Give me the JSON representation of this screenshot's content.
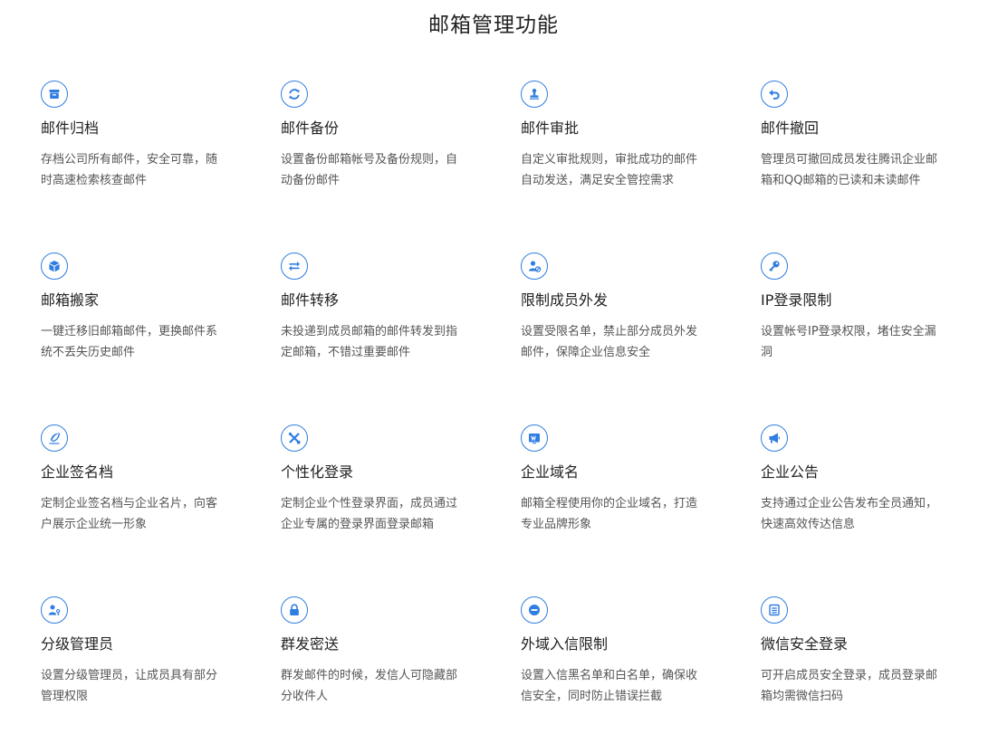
{
  "page": {
    "title": "邮箱管理功能"
  },
  "colors": {
    "accent": "#2f7de1",
    "title": "#222222",
    "text": "#555555"
  },
  "features": [
    {
      "title": "邮件归档",
      "desc": "存档公司所有邮件，安全可靠，随时高速检索核查邮件",
      "icon": "archive-icon"
    },
    {
      "title": "邮件备份",
      "desc": "设置备份邮箱帐号及备份规则，自动备份邮件",
      "icon": "sync-icon"
    },
    {
      "title": "邮件审批",
      "desc": "自定义审批规则，审批成功的邮件自动发送，满足安全管控需求",
      "icon": "stamp-icon"
    },
    {
      "title": "邮件撤回",
      "desc": "管理员可撤回成员发往腾讯企业邮箱和QQ邮箱的已读和未读邮件",
      "icon": "undo-icon"
    },
    {
      "title": "邮箱搬家",
      "desc": "一键迁移旧邮箱邮件，更换邮件系统不丢失历史邮件",
      "icon": "box-icon"
    },
    {
      "title": "邮件转移",
      "desc": "未投递到成员邮箱的邮件转发到指定邮箱，不错过重要邮件",
      "icon": "transfer-icon"
    },
    {
      "title": "限制成员外发",
      "desc": "设置受限名单，禁止部分成员外发邮件，保障企业信息安全",
      "icon": "user-block-icon"
    },
    {
      "title": "IP登录限制",
      "desc": "设置帐号IP登录权限，堵住安全漏洞",
      "icon": "key-icon"
    },
    {
      "title": "企业签名档",
      "desc": "定制企业签名档与企业名片，向客户展示企业统一形象",
      "icon": "feather-icon"
    },
    {
      "title": "个性化登录",
      "desc": "定制企业个性登录界面，成员通过企业专属的登录界面登录邮箱",
      "icon": "tools-icon"
    },
    {
      "title": "企业域名",
      "desc": "邮箱全程使用你的企业域名，打造专业品牌形象",
      "icon": "domain-icon"
    },
    {
      "title": "企业公告",
      "desc": "支持通过企业公告发布全员通知，快速高效传达信息",
      "icon": "megaphone-icon"
    },
    {
      "title": "分级管理员",
      "desc": "设置分级管理员，让成员具有部分管理权限",
      "icon": "admin-key-icon"
    },
    {
      "title": "群发密送",
      "desc": "群发邮件的时候，发信人可隐藏部分收件人",
      "icon": "lock-icon"
    },
    {
      "title": "外域入信限制",
      "desc": "设置入信黑名单和白名单，确保收信安全，同时防止错误拦截",
      "icon": "minus-circle-icon"
    },
    {
      "title": "微信安全登录",
      "desc": "可开启成员安全登录，成员登录邮箱均需微信扫码",
      "icon": "list-icon"
    }
  ]
}
